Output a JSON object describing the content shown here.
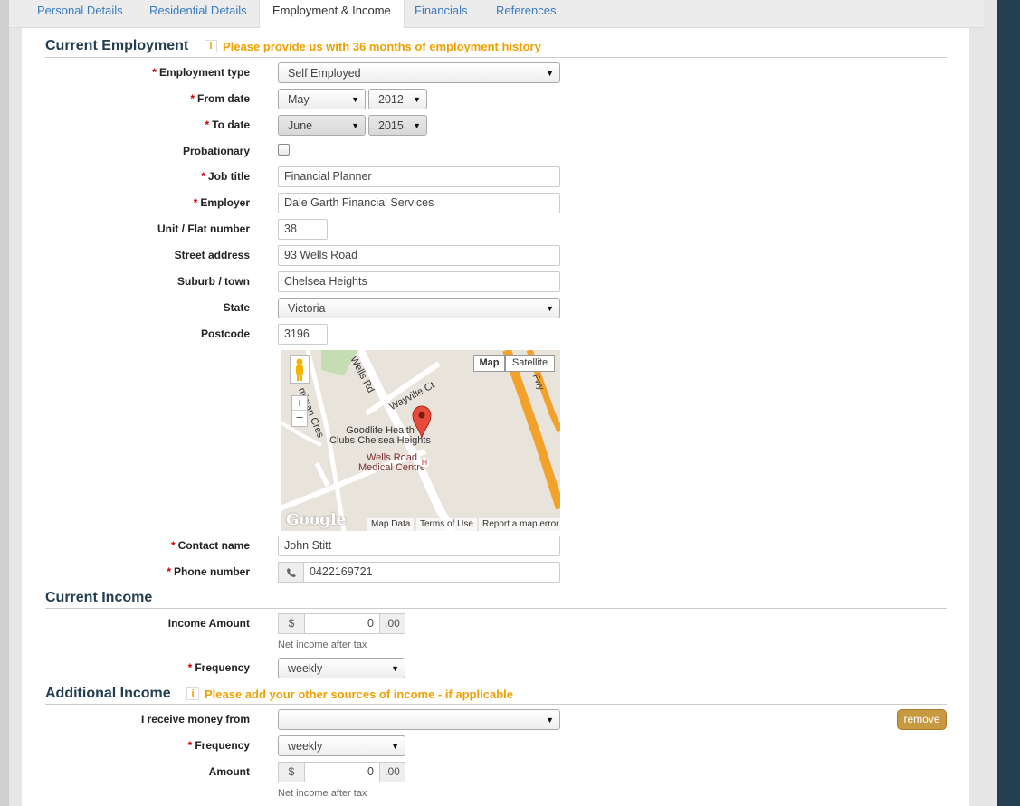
{
  "tabs": [
    {
      "label": "Personal Details"
    },
    {
      "label": "Residential Details"
    },
    {
      "label": "Employment & Income"
    },
    {
      "label": "Financials"
    },
    {
      "label": "References"
    }
  ],
  "current_employment": {
    "title": "Current Employment",
    "info_icon": "i",
    "notice": "Please provide us with 36 months of employment history",
    "employment_type": {
      "label": "Employment type",
      "value": "Self Employed"
    },
    "from_date": {
      "label": "From date",
      "month": "May",
      "year": "2012"
    },
    "to_date": {
      "label": "To date",
      "month": "June",
      "year": "2015"
    },
    "probationary": {
      "label": "Probationary",
      "checked": false
    },
    "job_title": {
      "label": "Job title",
      "value": "Financial Planner"
    },
    "employer": {
      "label": "Employer",
      "value": "Dale Garth Financial Services"
    },
    "unit": {
      "label": "Unit / Flat number",
      "value": "38"
    },
    "street": {
      "label": "Street address",
      "value": "93 Wells Road"
    },
    "suburb": {
      "label": "Suburb / town",
      "value": "Chelsea Heights"
    },
    "state": {
      "label": "State",
      "value": "Victoria"
    },
    "postcode": {
      "label": "Postcode",
      "value": "3196"
    },
    "map": {
      "map_button": "Map",
      "satellite_button": "Satellite",
      "zoom_in": "+",
      "zoom_out": "−",
      "road_wells": "Wells Rd",
      "road_wayville": "Wayville Ct",
      "road_armistan": "mistan Cres",
      "road_fwy": "Fwy",
      "poi_gym": "Goodlife Health\nClubs Chelsea Heights",
      "poi_medical": "Wells Road\nMedical Centre",
      "poi_h": "H",
      "logo": "Google",
      "footer_map_data": "Map Data",
      "footer_terms": "Terms of Use",
      "footer_report": "Report a map error"
    },
    "contact_name": {
      "label": "Contact name",
      "value": "John Stitt"
    },
    "phone": {
      "label": "Phone number",
      "value": "0422169721",
      "icon": "phone-icon"
    }
  },
  "current_income": {
    "title": "Current Income",
    "amount": {
      "label": "Income Amount",
      "prefix": "$",
      "value": "0",
      "suffix": ".00",
      "help": "Net income after tax"
    },
    "frequency": {
      "label": "Frequency",
      "value": "weekly"
    }
  },
  "additional_income": {
    "title": "Additional Income",
    "info_icon": "i",
    "notice": "Please add your other sources of income - if applicable",
    "source": {
      "label": "I receive money from",
      "value": ""
    },
    "remove_label": "remove",
    "frequency": {
      "label": "Frequency",
      "value": "weekly"
    },
    "amount": {
      "label": "Amount",
      "prefix": "$",
      "value": "0",
      "suffix": ".00",
      "help": "Net income after tax"
    }
  },
  "required_marker": "*",
  "dropdown_arrow": "▼",
  "colors": {
    "accent": "#f0a000",
    "link": "#3a7bbf",
    "heading": "#223e50",
    "button": "#c79a42",
    "required": "#cc0000",
    "sidebar": "#223e50"
  }
}
